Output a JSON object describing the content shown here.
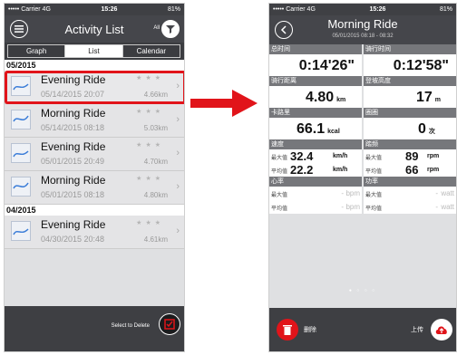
{
  "status": {
    "carrier": "••••• Carrier",
    "network": "4G",
    "time": "15:26",
    "battery": "81%"
  },
  "left": {
    "nav_title": "Activity List",
    "filter_label": "All",
    "tabs": [
      "Graph",
      "List",
      "Calendar"
    ],
    "active_tab": "List",
    "months": [
      {
        "label": "05/2015",
        "items": [
          {
            "title": "Evening Ride",
            "date": "05/14/2015 20:07",
            "distance": "4.66km",
            "selected": true
          },
          {
            "title": "Morning Ride",
            "date": "05/14/2015 08:18",
            "distance": "5.03km"
          },
          {
            "title": "Evening Ride",
            "date": "05/01/2015 20:49",
            "distance": "4.70km"
          },
          {
            "title": "Morning Ride",
            "date": "05/01/2015 08:18",
            "distance": "4.80km"
          }
        ]
      },
      {
        "label": "04/2015",
        "items": [
          {
            "title": "Evening Ride",
            "date": "04/30/2015 20:48",
            "distance": "4.61km"
          }
        ]
      }
    ],
    "delete_label": "Select to Delete"
  },
  "right": {
    "title": "Morning Ride",
    "subtitle": "05/01/2015 08:18 - 08:32",
    "total_time_label": "总时间",
    "total_time": "0:14'26\"",
    "riding_time_label": "骑行时间",
    "riding_time": "0:12'58\"",
    "distance_label": "骑行距离",
    "distance": "4.80",
    "distance_unit": "km",
    "climb_label": "登坡高度",
    "climb": "17",
    "climb_unit": "m",
    "calorie_label": "卡路里",
    "calorie": "66.1",
    "calorie_unit": "kcal",
    "laps_label": "圈圈",
    "laps": "0",
    "laps_unit": "次",
    "speed_label": "速度",
    "max_label": "最大值",
    "avg_label": "平均值",
    "speed_max": "32.4",
    "speed_avg": "22.2",
    "speed_unit": "km/h",
    "cadence_label": "踏频",
    "cadence_max": "89",
    "cadence_avg": "66",
    "cadence_unit": "rpm",
    "hr_label": "心率",
    "hr_dash": "-",
    "hr_unit": "bpm",
    "power_label": "功率",
    "power_dash": "-",
    "power_unit": "watt",
    "delete_label": "删除",
    "upload_label": "上传"
  },
  "colors": {
    "accent_red": "#e1141a",
    "navbar": "#45464b"
  }
}
